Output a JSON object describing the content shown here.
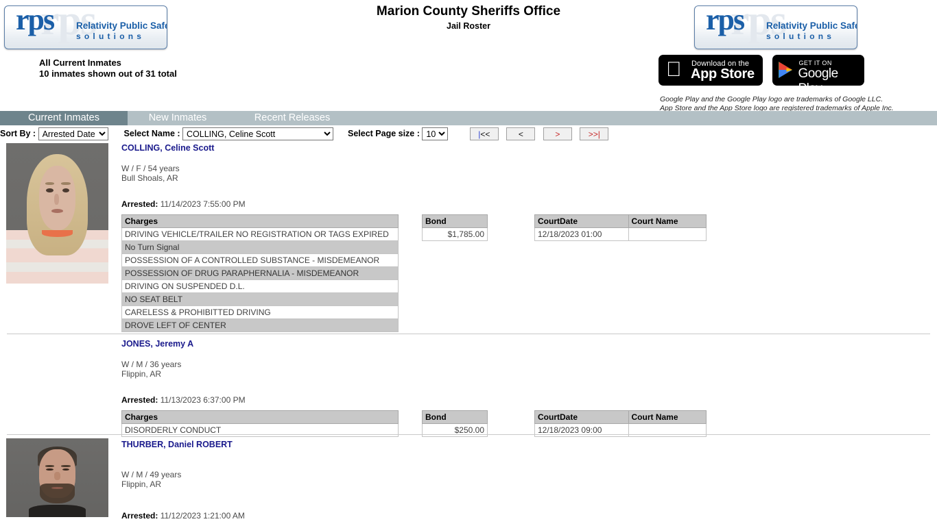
{
  "header": {
    "title": "Marion County Sheriffs Office",
    "subtitle": "Jail Roster",
    "roster_heading_line1": "All Current Inmates",
    "roster_heading_line2": "10 inmates shown out of 31 total",
    "logo": {
      "ghost_text": "rps",
      "mark": "rps",
      "line1": "Relativity Public Safety",
      "line2": "solutions"
    },
    "badges": {
      "apple_small": "Download on the",
      "apple_large": "App Store",
      "google_small": "GET IT ON",
      "google_large": "Google Play"
    },
    "trademark_line1": "Google Play and the Google Play logo are trademarks of Google LLC.",
    "trademark_line2": "App Store and the App Store logo are registered trademarks of Apple Inc."
  },
  "tabs": [
    {
      "label": "Current Inmates",
      "active": true
    },
    {
      "label": "New Inmates",
      "active": false
    },
    {
      "label": "Recent Releases",
      "active": false
    }
  ],
  "toolbar": {
    "sort_label": "Sort By :",
    "sort_value": "Arrested Date",
    "name_label": "Select Name :",
    "name_value": "COLLING, Celine Scott",
    "pagesize_label": "Select Page size :",
    "pagesize_value": "10",
    "btn_first": "|<<",
    "btn_prev": "<",
    "btn_next": ">",
    "btn_last": ">>|"
  },
  "table_headers": {
    "charges": "Charges",
    "bond": "Bond",
    "courtdate": "CourtDate",
    "courtname": "Court Name"
  },
  "labels": {
    "arrested": "Arrested:"
  },
  "colors": {
    "tab_bar": "#b3c0c5",
    "tab_active": "#6e848c",
    "name_link": "#1a1a8c",
    "header_cell": "#c8c8c8",
    "logo_blue": "#1b5fa8"
  },
  "inmates": [
    {
      "name": "COLLING, Celine Scott",
      "demographics": "W / F / 54 years",
      "city": "Bull Shoals, AR",
      "arrested": "11/14/2023 7:55:00 PM",
      "has_photo": true,
      "charges": [
        "DRIVING VEHICLE/TRAILER NO REGISTRATION OR TAGS EXPIRED",
        "No Turn Signal",
        "POSSESSION OF A CONTROLLED SUBSTANCE - MISDEMEANOR",
        "POSSESSION OF DRUG PARAPHERNALIA - MISDEMEANOR",
        "DRIVING ON SUSPENDED D.L.",
        "NO SEAT BELT",
        "CARELESS & PROHIBITTED DRIVING",
        "DROVE LEFT OF CENTER"
      ],
      "bond": "$1,785.00",
      "courtdate": "12/18/2023 01:00",
      "courtname": ""
    },
    {
      "name": "JONES, Jeremy A",
      "demographics": "W / M / 36 years",
      "city": "Flippin, AR",
      "arrested": "11/13/2023 6:37:00 PM",
      "has_photo": false,
      "charges": [
        "DISORDERLY CONDUCT"
      ],
      "bond": "$250.00",
      "courtdate": "12/18/2023 09:00",
      "courtname": ""
    },
    {
      "name": "THURBER, Daniel ROBERT",
      "demographics": "W / M / 49 years",
      "city": "Flippin, AR",
      "arrested": "11/12/2023 1:21:00 AM",
      "has_photo": true,
      "charges": [],
      "bond": "",
      "courtdate": "",
      "courtname": ""
    }
  ]
}
